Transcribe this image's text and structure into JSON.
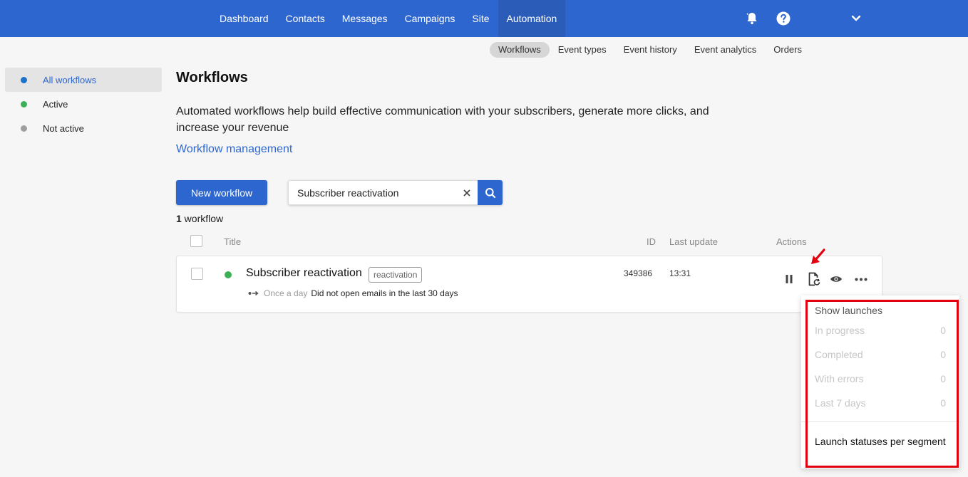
{
  "topnav": {
    "items": [
      "Dashboard",
      "Contacts",
      "Messages",
      "Campaigns",
      "Site",
      "Automation"
    ],
    "active_index": 5
  },
  "subnav": {
    "items": [
      "Workflows",
      "Event types",
      "Event history",
      "Event analytics",
      "Orders"
    ],
    "active_index": 0
  },
  "sidebar": {
    "items": [
      {
        "label": "All workflows",
        "color": "#1a73c8"
      },
      {
        "label": "Active",
        "color": "#3cb054"
      },
      {
        "label": "Not active",
        "color": "#9e9e9e"
      }
    ]
  },
  "main": {
    "title": "Workflows",
    "description": "Automated workflows help build effective communication with your subscribers, generate more clicks, and increase your revenue",
    "management_link": "Workflow management",
    "new_button": "New workflow",
    "search_value": "Subscriber reactivation",
    "count_number": "1",
    "count_label": " workflow"
  },
  "table": {
    "headers": {
      "title": "Title",
      "id": "ID",
      "last_update": "Last update",
      "actions": "Actions"
    },
    "rows": [
      {
        "title": "Subscriber reactivation",
        "tag": "reactivation",
        "frequency": "Once a day",
        "condition": "Did not open emails in the last 30 days",
        "id": "349386",
        "last_update": "13:31",
        "status_color": "#3cb054"
      }
    ]
  },
  "popover": {
    "title": "Show launches",
    "rows": [
      {
        "label": "In progress",
        "value": "0"
      },
      {
        "label": "Completed",
        "value": "0"
      },
      {
        "label": "With errors",
        "value": "0"
      },
      {
        "label": "Last 7 days",
        "value": "0"
      }
    ],
    "link": "Launch statuses per segment"
  },
  "colors": {
    "brand": "#2d66cf",
    "highlight": "#e3000f"
  }
}
